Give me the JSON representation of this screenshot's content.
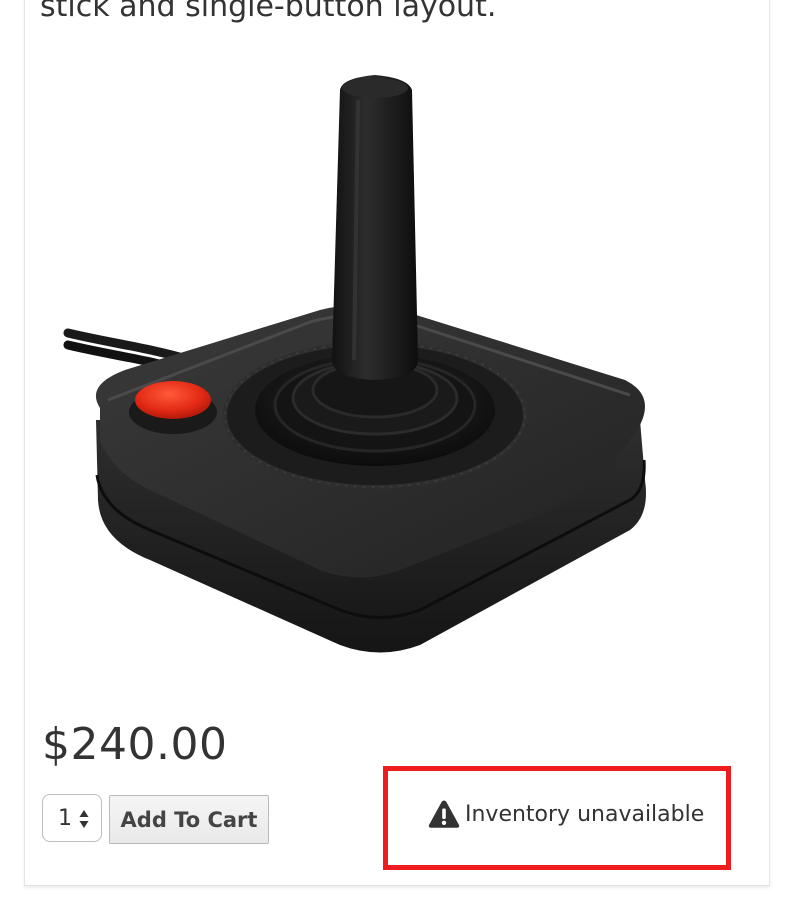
{
  "product": {
    "description_fragment": "stick and single-button layout.",
    "image_icon": "atari-joystick-image",
    "price": "$240.00"
  },
  "cart": {
    "quantity": "1",
    "add_to_cart_label": "Add To Cart"
  },
  "inventory": {
    "status_text": "Inventory unavailable",
    "status_icon": "warning-icon",
    "highlight_color": "#ee1c1c"
  }
}
